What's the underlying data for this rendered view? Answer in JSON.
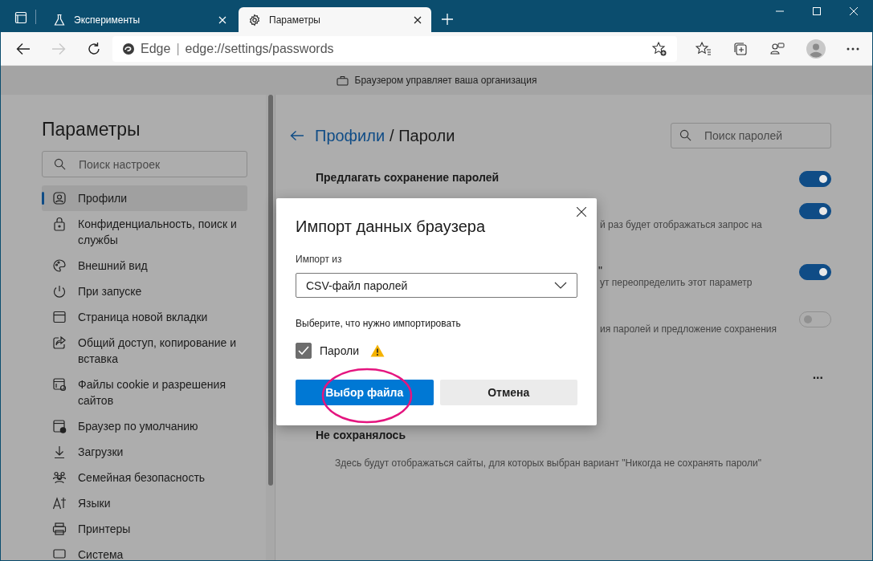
{
  "tabs": [
    {
      "label": "Эксперименты",
      "selected": false
    },
    {
      "label": "Параметры",
      "selected": true
    }
  ],
  "address_bar": {
    "site_label": "Edge",
    "separator": "|",
    "url": "edge://settings/passwords"
  },
  "toolbar": {
    "forward_disabled": true
  },
  "info_bar": {
    "text": "Браузером управляет ваша организация"
  },
  "sidebar": {
    "title": "Параметры",
    "search": {
      "placeholder": "Поиск настроек"
    },
    "items": [
      {
        "label": "Профили",
        "selected": true
      },
      {
        "label": "Конфиденциальность, поиск и службы",
        "selected": false
      },
      {
        "label": "Внешний вид",
        "selected": false
      },
      {
        "label": "При запуске",
        "selected": false
      },
      {
        "label": "Страница новой вкладки",
        "selected": false
      },
      {
        "label": "Общий доступ, копирование и вставка",
        "selected": false
      },
      {
        "label": "Файлы cookie и разрешения сайтов",
        "selected": false
      },
      {
        "label": "Браузер по умолчанию",
        "selected": false
      },
      {
        "label": "Загрузки",
        "selected": false
      },
      {
        "label": "Семейная безопасность",
        "selected": false
      },
      {
        "label": "Языки",
        "selected": false
      },
      {
        "label": "Принтеры",
        "selected": false
      },
      {
        "label": "Система",
        "selected": false
      }
    ]
  },
  "main": {
    "breadcrumb_parent": "Профили",
    "breadcrumb_current": "/ Пароли",
    "search": {
      "placeholder": "Поиск паролей"
    },
    "settings": [
      {
        "title": "Предлагать сохранение паролей",
        "on": true
      },
      {
        "description_fragment": "й раз будет отображаться запрос на",
        "on": true
      },
      {
        "title": "\"",
        "description_fragment": "ут переопределить этот параметр",
        "on": true
      },
      {
        "description_fragment": "ия паролей и предложение сохранения",
        "on": false
      }
    ],
    "more_menu": "...",
    "never_saved": {
      "title": "Не сохранялось",
      "description": "Здесь будут отображаться сайты, для которых выбран вариант \"Никогда не сохранять пароли\""
    }
  },
  "dialog": {
    "title": "Импорт данных браузера",
    "source_label": "Импорт из",
    "source_value": "CSV-файл паролей",
    "choose_label": "Выберите, что нужно импортировать",
    "options": [
      {
        "label": "Пароли",
        "checked": true,
        "warning": true
      }
    ],
    "buttons": [
      {
        "label": "Выбор файла",
        "kind": "primary"
      },
      {
        "label": "Отмена",
        "kind": "secondary"
      }
    ],
    "highlight": true
  }
}
